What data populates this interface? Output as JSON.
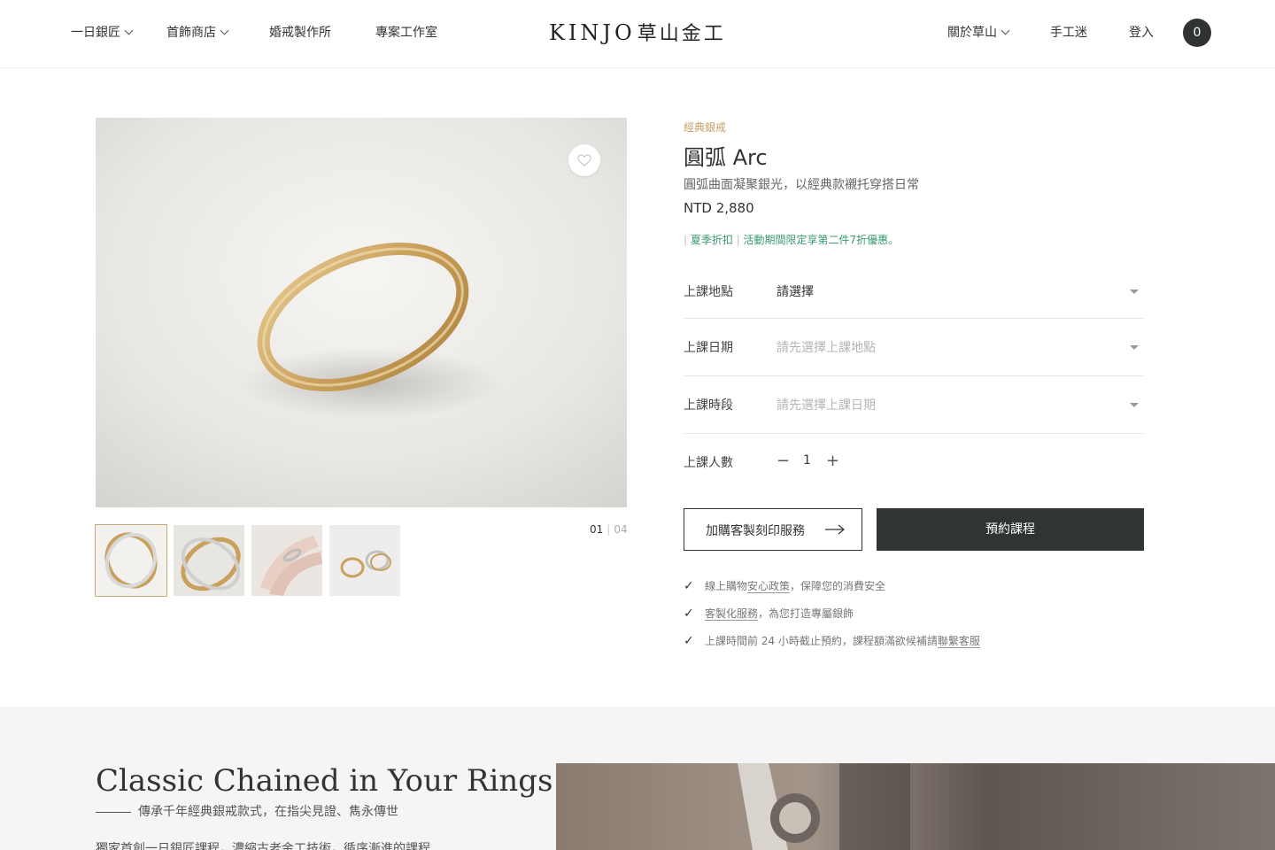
{
  "header": {
    "nav_left": [
      {
        "label": "一日銀匠",
        "has_dropdown": true
      },
      {
        "label": "首飾商店",
        "has_dropdown": true
      },
      {
        "label": "婚戒製作所",
        "has_dropdown": false
      },
      {
        "label": "專案工作室",
        "has_dropdown": false
      }
    ],
    "logo_latin": "KINJO",
    "logo_cjk": "草山金工",
    "nav_right": [
      {
        "label": "關於草山",
        "has_dropdown": true
      },
      {
        "label": "手工迷",
        "has_dropdown": false
      },
      {
        "label": "登入",
        "has_dropdown": false
      }
    ],
    "cart_count": "0"
  },
  "gallery": {
    "current": "01",
    "total": "04",
    "thumbnails": [
      "ring-pair-thumb",
      "ring-twist-thumb",
      "hand-ring-thumb",
      "rings-on-table-thumb"
    ]
  },
  "product": {
    "category": "經典銀戒",
    "title": "圓弧 Arc",
    "subtitle": "圓弧曲面凝聚銀光，以經典款襯托穿搭日常",
    "price": "NTD 2,880",
    "promo_tag": "夏季折扣",
    "promo_text": "活動期間限定享第二件7折優惠。"
  },
  "options": {
    "location": {
      "label": "上課地點",
      "value": "請選擇"
    },
    "date": {
      "label": "上課日期",
      "value": "請先選擇上課地點"
    },
    "time": {
      "label": "上課時段",
      "value": "請先選擇上課日期"
    },
    "people": {
      "label": "上課人數",
      "value": "1",
      "minus": "−",
      "plus": "+"
    }
  },
  "actions": {
    "engrave_label": "加購客製刻印服務",
    "book_label": "預約課程"
  },
  "assurances": [
    {
      "pre": "線上購物",
      "link": "安心政策",
      "post": "，保障您的消費安全"
    },
    {
      "pre": "",
      "link": "客製化服務",
      "post": "，為您打造專屬銀飾"
    },
    {
      "pre": "上課時間前 24 小時截止預約，課程額滿欲候補請",
      "link": "聯繫客服",
      "post": ""
    }
  ],
  "check_glyph": "✓",
  "lower": {
    "title": "Classic Chained in Your Rings",
    "subtitle": "傳承千年經典銀戒款式，在指尖見證、雋永傳世",
    "body": "獨家首創一日銀匠課程，濃縮古老金工技術，循序漸進的課程"
  },
  "colors": {
    "accent_gold": "#c9a06a",
    "promo_green": "#3a9a6e",
    "dark_button": "#2f3532",
    "lower_bg": "#f5f5f5"
  }
}
